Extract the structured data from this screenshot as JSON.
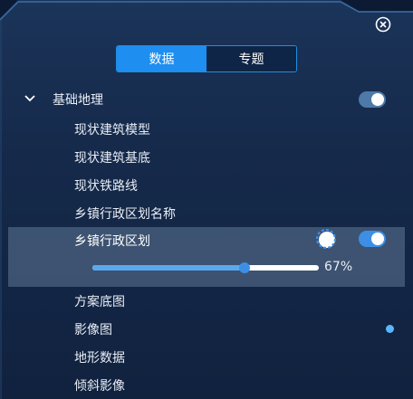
{
  "colors": {
    "accent": "#1e8ef0",
    "panel": "#15294a",
    "selection": "#58708f"
  },
  "tabs": [
    {
      "label": "数据",
      "active": true
    },
    {
      "label": "专题",
      "active": false
    }
  ],
  "group": {
    "label": "基础地理",
    "expanded": true,
    "toggle_on": true
  },
  "layers": [
    {
      "label": "现状建筑模型"
    },
    {
      "label": "现状建筑基底"
    },
    {
      "label": "现状铁路线"
    },
    {
      "label": "乡镇行政区划名称"
    }
  ],
  "selected_layer": {
    "label": "乡镇行政区划",
    "toggle_on": true,
    "opacity_value": 0.67,
    "opacity_text": "67%",
    "loading_icon": "loading-spinner-icon"
  },
  "layers_after": [
    {
      "label": "方案底图"
    },
    {
      "label": "影像图"
    },
    {
      "label": "地形数据"
    },
    {
      "label": "倾斜影像"
    }
  ],
  "icons": {
    "close": "close-circle-icon",
    "chevron": "chevron-down-icon"
  }
}
